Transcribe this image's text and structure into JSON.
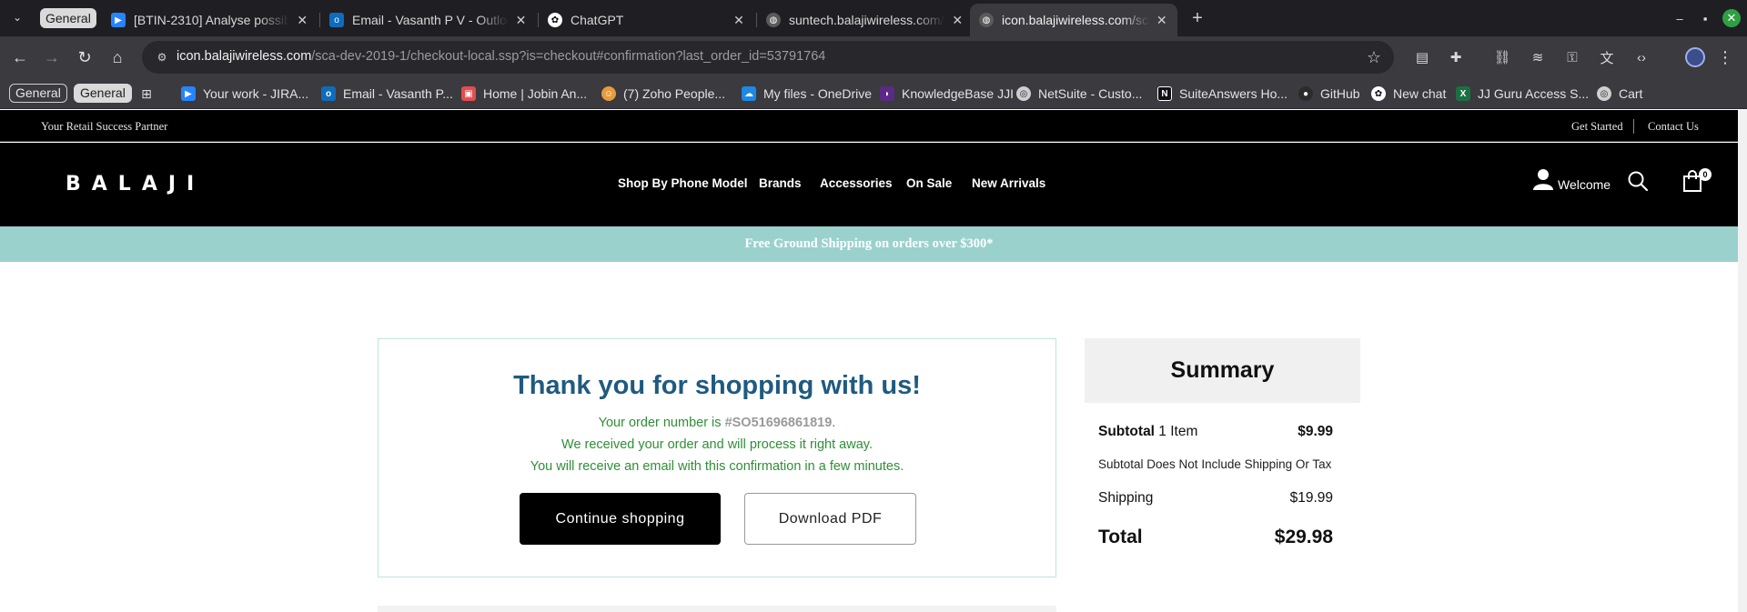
{
  "browser": {
    "tab_group_label": "General",
    "tabs": [
      {
        "title": "[BTIN-2310] Analyse possibl",
        "favicon": "jira-icon",
        "color": "#2684ff"
      },
      {
        "title": "Email - Vasanth P V - Outlook",
        "favicon": "outlook-icon",
        "color": "#0f6cbd"
      },
      {
        "title": "ChatGPT",
        "favicon": "chatgpt-icon",
        "color": "#ffffff"
      },
      {
        "title": "suntech.balajiwireless.com/c",
        "favicon": "globe-icon",
        "color": "#9a9a9a"
      },
      {
        "title": "icon.balajiwireless.com/sca-c",
        "favicon": "globe-icon",
        "color": "#9a9a9a"
      }
    ],
    "url": {
      "host": "icon.balajiwireless.com",
      "path": "/sca-dev-2019-1/checkout-local.ssp?is=checkout#confirmation?last_order_id=53791764"
    },
    "bookmarks": {
      "chips": [
        "General",
        "General"
      ],
      "items": [
        {
          "label": "Your work - JIRA...",
          "icon": "jira-icon",
          "color": "#2684ff"
        },
        {
          "label": "Email - Vasanth P...",
          "icon": "outlook-icon",
          "color": "#0f6cbd"
        },
        {
          "label": "Home | Jobin An...",
          "icon": "home-app-icon",
          "color": "#e44d4d"
        },
        {
          "label": "(7) Zoho People...",
          "icon": "zoho-icon",
          "color": "#e89b3c"
        },
        {
          "label": "My files - OneDrive",
          "icon": "onedrive-icon",
          "color": "#1e88e5"
        },
        {
          "label": "KnowledgeBase JJI",
          "icon": "knowledgebase-icon",
          "color": "#5b2a86"
        },
        {
          "label": "NetSuite - Custo...",
          "icon": "netsuite-icon",
          "color": "#cfcfcf"
        },
        {
          "label": "SuiteAnswers Ho...",
          "icon": "notion-icon",
          "color": "#111111"
        },
        {
          "label": "GitHub",
          "icon": "github-icon",
          "color": "#2b2b2b"
        },
        {
          "label": "New chat",
          "icon": "chatgpt-icon",
          "color": "#ffffff"
        },
        {
          "label": "JJ Guru Access S...",
          "icon": "excel-icon",
          "color": "#1d6f42"
        },
        {
          "label": "Cart",
          "icon": "cart-bookmark-icon",
          "color": "#cfcfcf"
        }
      ]
    }
  },
  "site": {
    "tagline": "Your Retail Success Partner",
    "top_links": [
      "Get Started",
      "Contact Us"
    ],
    "logo": "BALAJI",
    "nav": [
      "Shop By Phone Model",
      "Brands",
      "Accessories",
      "On Sale",
      "New Arrivals"
    ],
    "welcome": "Welcome",
    "cart_count": "0",
    "promo": "Free Ground Shipping on orders over $300*"
  },
  "confirmation": {
    "title": "Thank you for shopping with us!",
    "order_prefix": "Your order number is ",
    "order_number": "#SO51696861819",
    "order_suffix": ".",
    "line2": "We received your order and will process it right away.",
    "line3": "You will receive an email with this confirmation in a few minutes.",
    "continue_label": "Continue shopping",
    "download_label": "Download PDF"
  },
  "summary": {
    "title": "Summary",
    "subtotal_label": "Subtotal",
    "subtotal_items": " 1 Item",
    "subtotal_value": "$9.99",
    "note": "Subtotal Does Not Include Shipping Or Tax",
    "shipping_label": "Shipping",
    "shipping_value": "$19.99",
    "total_label": "Total",
    "total_value": "$29.98"
  },
  "colors": {
    "promo_bg": "#9ad1cd",
    "title_blue": "#1f5a80",
    "confirm_green": "#2e8f36",
    "header_black": "#000000"
  }
}
